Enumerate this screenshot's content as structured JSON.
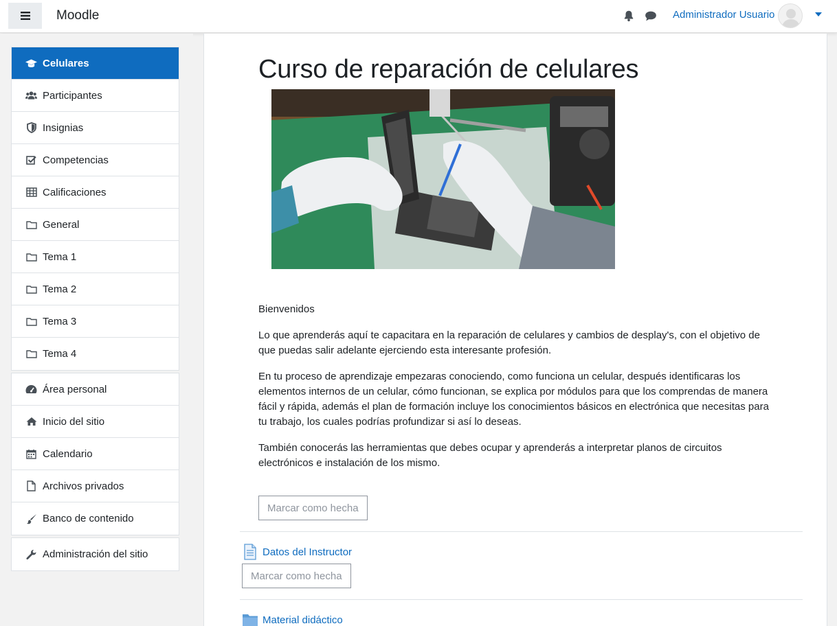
{
  "navbar": {
    "brand": "Moodle",
    "user_name": "Administrador Usuario",
    "icons": [
      "menu-icon",
      "bell-icon",
      "chat-icon",
      "caret-down-icon"
    ]
  },
  "drawer": {
    "course_items": [
      {
        "label": "Celulares",
        "icon": "graduation-cap-icon",
        "active": true
      },
      {
        "label": "Participantes",
        "icon": "users-icon"
      },
      {
        "label": "Insignias",
        "icon": "shield-icon"
      },
      {
        "label": "Competencias",
        "icon": "checkbox-icon"
      },
      {
        "label": "Calificaciones",
        "icon": "table-icon"
      },
      {
        "label": "General",
        "icon": "folder-icon"
      },
      {
        "label": "Tema 1",
        "icon": "folder-icon"
      },
      {
        "label": "Tema 2",
        "icon": "folder-icon"
      },
      {
        "label": "Tema 3",
        "icon": "folder-icon"
      },
      {
        "label": "Tema 4",
        "icon": "folder-icon"
      }
    ],
    "site_items": [
      {
        "label": "Área personal",
        "icon": "dashboard-icon"
      },
      {
        "label": "Inicio del sitio",
        "icon": "home-icon"
      },
      {
        "label": "Calendario",
        "icon": "calendar-icon"
      },
      {
        "label": "Archivos privados",
        "icon": "file-icon"
      },
      {
        "label": "Banco de contenido",
        "icon": "brush-icon"
      }
    ],
    "admin_items": [
      {
        "label": "Administración del sitio",
        "icon": "wrench-icon"
      }
    ]
  },
  "course": {
    "title": "Curso de reparación de celulares",
    "summary": [
      "Bienvenidos",
      "Lo que aprenderás aquí te capacitara en la reparación de celulares y cambios de desplay's, con el objetivo de que puedas salir adelante ejerciendo esta interesante profesión.",
      "En tu proceso de aprendizaje empezaras conociendo, como funciona un celular, después identificaras los elementos internos de un celular, cómo funcionan, se explica por módulos para que los comprendas de manera fácil y rápida, además el plan de formación incluye los conocimientos básicos en electrónica que necesitas para tu trabajo, los cuales podrías profundizar si así lo deseas.",
      "También conocerás las herramientas que debes ocupar y aprenderás a interpretar planos de circuitos electrónicos e instalación de los mismo."
    ],
    "mark_done_label": "Marcar como hecha",
    "activities": [
      {
        "label": "Datos del Instructor",
        "icon": "page-icon",
        "mark_done_label": "Marcar como hecha"
      },
      {
        "label": "Material didáctico",
        "icon": "folder-blue-icon"
      }
    ]
  }
}
